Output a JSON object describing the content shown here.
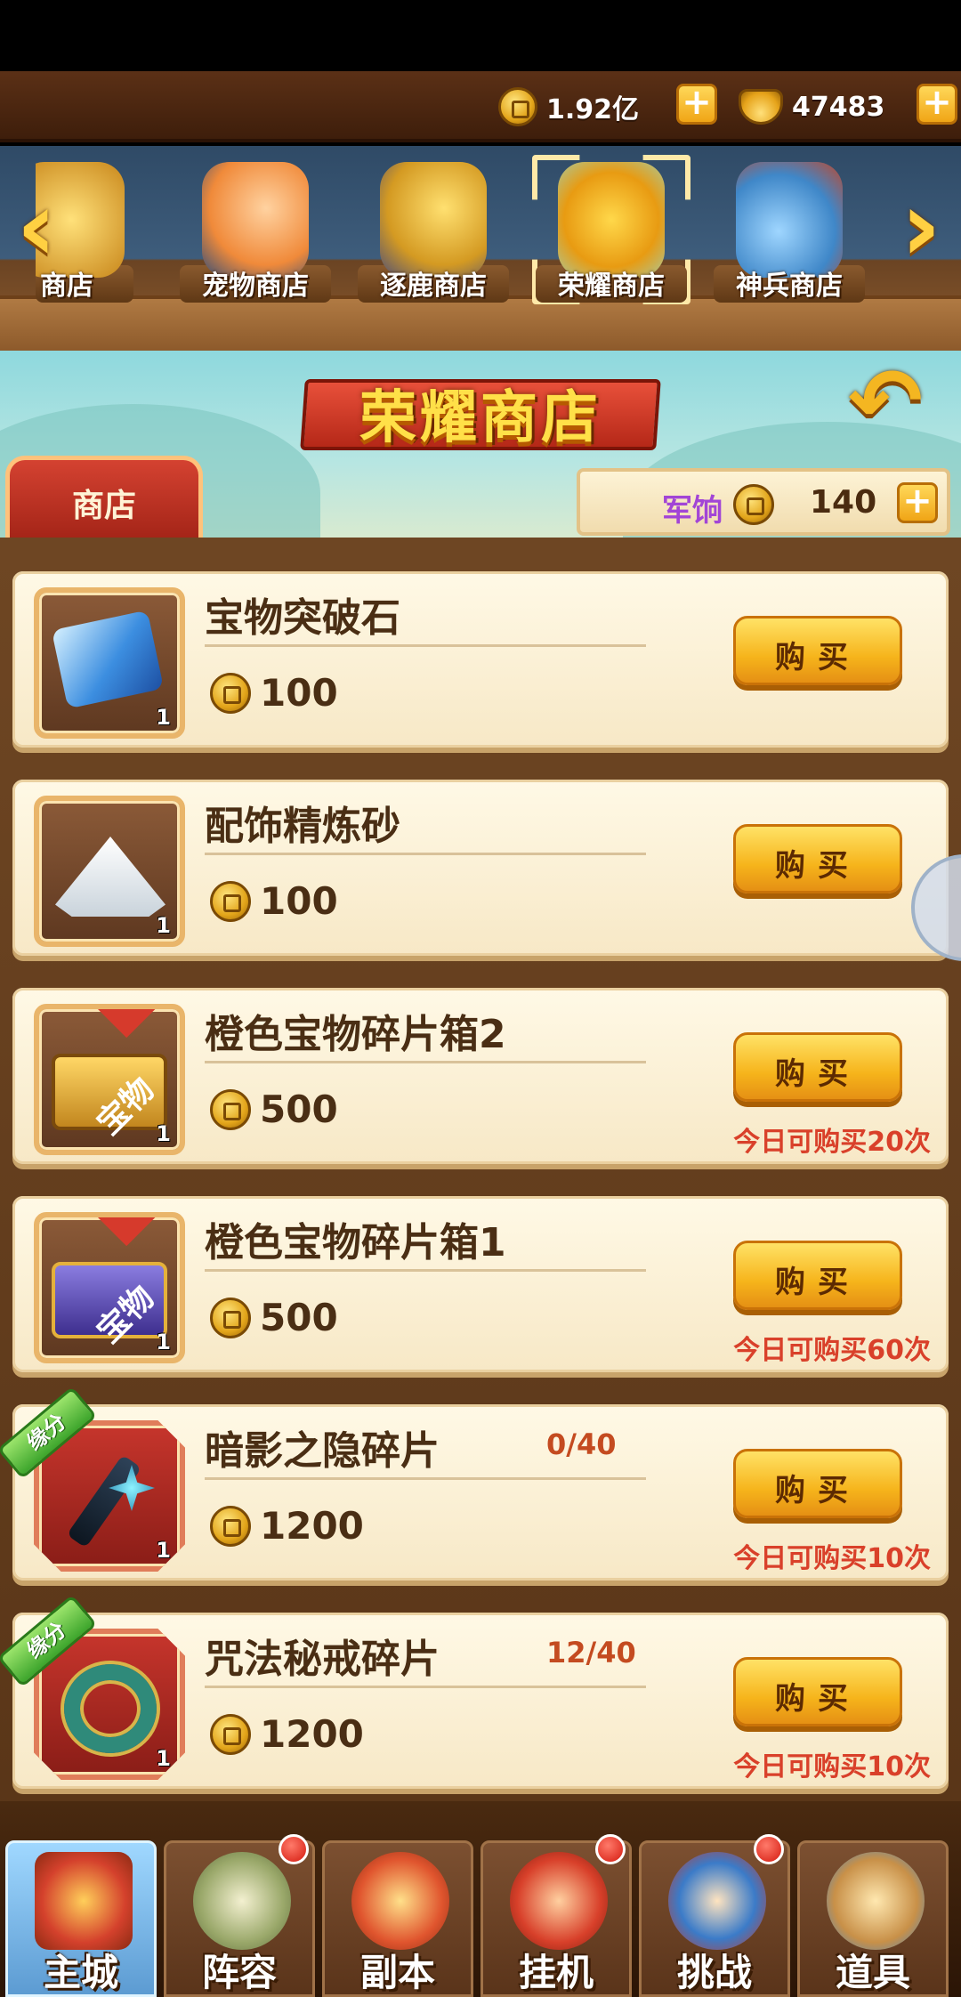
{
  "currencies": {
    "gold": "1.92亿",
    "ingot": "47483"
  },
  "shop_tabs": [
    {
      "label": "商店",
      "art_color": "#d7a13a",
      "selected": false
    },
    {
      "label": "宠物商店",
      "art_color": "#f3a55b",
      "selected": false
    },
    {
      "label": "逐鹿商店",
      "art_color": "#e2b041",
      "selected": false
    },
    {
      "label": "荣耀商店",
      "art_color": "#e8b22a",
      "selected": true
    },
    {
      "label": "神兵商店",
      "art_color": "#6fb3e8",
      "selected": false
    }
  ],
  "banner": {
    "title": "荣耀商店",
    "shop_tag": "商店",
    "currency_label": "军饷",
    "currency_value": "140"
  },
  "items": [
    {
      "name": "宝物突破石",
      "price": "100",
      "count": "1",
      "icon": "blue-stone-icon",
      "frame": "brown",
      "badge": "",
      "progress": "",
      "limit": "",
      "buy_label": "购买"
    },
    {
      "name": "配饰精炼砂",
      "price": "100",
      "count": "1",
      "icon": "sand-pile-icon",
      "frame": "brown",
      "badge": "",
      "progress": "",
      "limit": "",
      "buy_label": "购买"
    },
    {
      "name": "橙色宝物碎片箱2",
      "price": "500",
      "count": "1",
      "icon": "gold-chest-icon",
      "frame": "brown",
      "badge": "宝物",
      "progress": "",
      "limit": "今日可购买20次",
      "buy_label": "购买"
    },
    {
      "name": "橙色宝物碎片箱1",
      "price": "500",
      "count": "1",
      "icon": "purple-chest-icon",
      "frame": "brown",
      "badge": "宝物",
      "progress": "",
      "limit": "今日可购买60次",
      "buy_label": "购买"
    },
    {
      "name": "暗影之隐碎片",
      "price": "1200",
      "count": "1",
      "icon": "shadow-staff-icon",
      "frame": "red",
      "badge": "缘分",
      "progress": "0/40",
      "limit": "今日可购买10次",
      "buy_label": "购买"
    },
    {
      "name": "咒法秘戒碎片",
      "price": "1200",
      "count": "1",
      "icon": "jade-ring-icon",
      "frame": "red",
      "badge": "缘分",
      "progress": "12/40",
      "limit": "今日可购买10次",
      "buy_label": "购买"
    }
  ],
  "bottom_nav": [
    {
      "label": "主城",
      "icon": "city-gate-icon",
      "active": true,
      "dot": false
    },
    {
      "label": "阵容",
      "icon": "lineup-icon",
      "active": false,
      "dot": true
    },
    {
      "label": "副本",
      "icon": "dungeon-icon",
      "active": false,
      "dot": false
    },
    {
      "label": "挂机",
      "icon": "idle-bag-icon",
      "active": false,
      "dot": true
    },
    {
      "label": "挑战",
      "icon": "challenge-icon",
      "active": false,
      "dot": true
    },
    {
      "label": "道具",
      "icon": "items-icon",
      "active": false,
      "dot": false
    }
  ]
}
